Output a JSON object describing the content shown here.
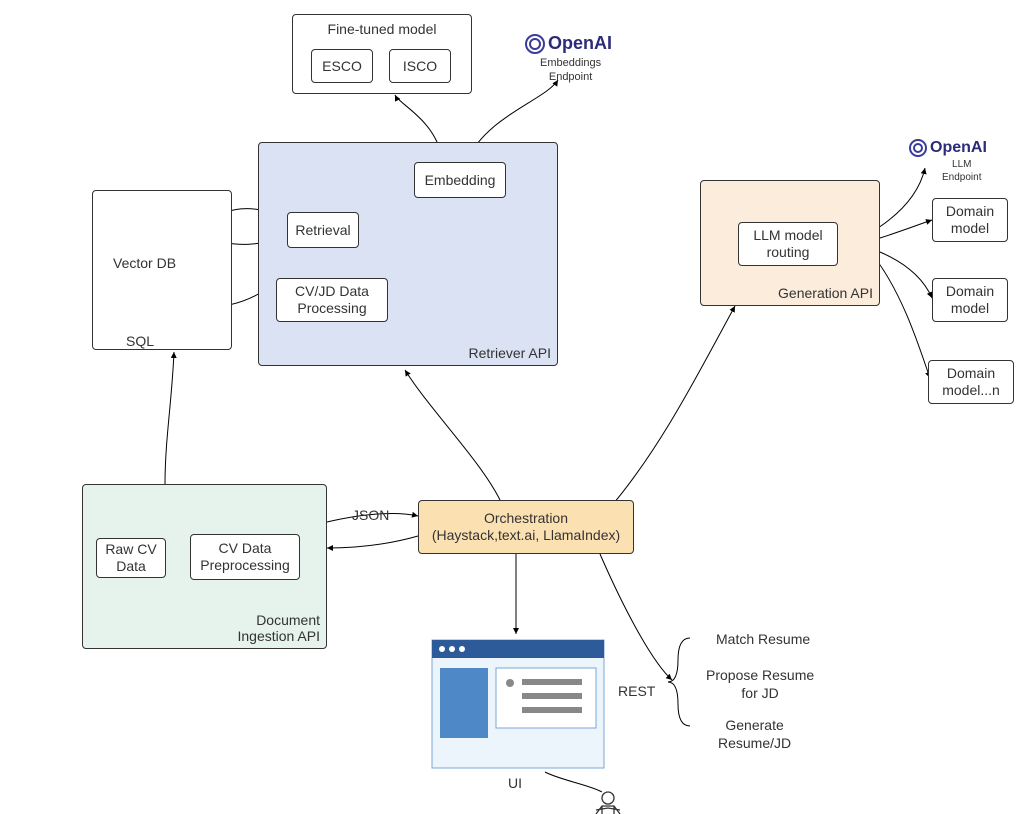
{
  "openai_top": {
    "name": "OpenAI",
    "sub": "Embeddings\nEndpoint"
  },
  "openai_right": {
    "name": "OpenAI",
    "sub": "LLM\nEndpoint"
  },
  "finetuned": {
    "title": "Fine-tuned model",
    "box1": "ESCO",
    "box2": "ISCO"
  },
  "databases": {
    "vector": "Vector DB",
    "sql": "SQL"
  },
  "retriever": {
    "label": "Retriever API",
    "embedding": "Embedding",
    "retrieval": "Retrieval",
    "processing": "CV/JD Data\nProcessing"
  },
  "generation": {
    "label": "Generation API",
    "routing": "LLM model\nrouting",
    "d1": "Domain\nmodel",
    "d2": "Domain\nmodel",
    "d3": "Domain\nmodel...n"
  },
  "doc_api": {
    "label": "Document\nIngestion API",
    "raw": "Raw CV\nData",
    "pre": "CV Data\nPreprocessing"
  },
  "orchestration": "Orchestration\n(Haystack,text.ai, LlamaIndex)",
  "ui_label": "UI",
  "json_label": "JSON",
  "rest_label": "REST",
  "actions": {
    "a1": "Match Resume",
    "a2": "Propose Resume\nfor JD",
    "a3": "Generate\nResume/JD"
  }
}
